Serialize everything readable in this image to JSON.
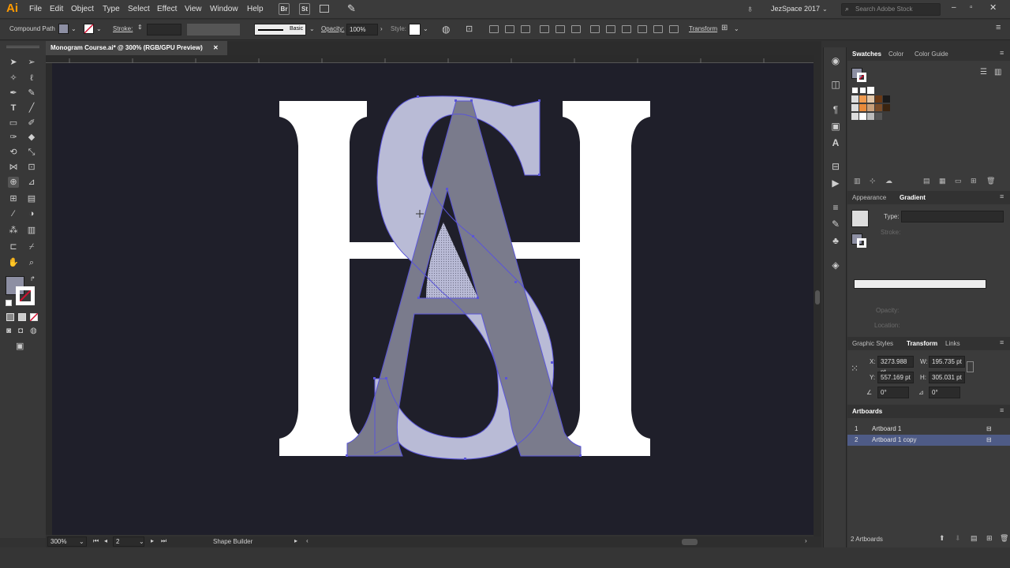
{
  "app": {
    "logo": "Ai",
    "workspace": "JezSpace 2017",
    "search_placeholder": "Search Adobe Stock"
  },
  "menu": [
    "File",
    "Edit",
    "Object",
    "Type",
    "Select",
    "Effect",
    "View",
    "Window",
    "Help"
  ],
  "bridge_buttons": [
    "Br",
    "St"
  ],
  "control": {
    "selection_type": "Compound Path",
    "stroke_label": "Stroke:",
    "brush": "Basic",
    "opacity_label": "Opacity:",
    "opacity_value": "100%",
    "style_label": "Style:",
    "transform_label": "Transform"
  },
  "document": {
    "tab_title": "Monogram Course.ai* @ 300% (RGB/GPU Preview)",
    "close": "✕"
  },
  "canvas": {
    "bg": "#1f1f2a",
    "letter_fill": "#ffffff",
    "overlay_light": "#b9bbd6",
    "overlay_dark": "#7a7b8c",
    "path_color": "#5a55d8"
  },
  "panels": {
    "swatches_tabs": [
      "Swatches",
      "Color",
      "Color Guide"
    ],
    "appearance_tabs": [
      "Appearance",
      "Gradient"
    ],
    "gradient": {
      "type_label": "Type:",
      "stroke_label": "Stroke:",
      "opacity_label": "Opacity:",
      "location_label": "Location:"
    },
    "transform_tabs": [
      "Graphic Styles",
      "Transform",
      "Links"
    ],
    "transform": {
      "x_label": "X:",
      "x_value": "3273.988 pt",
      "y_label": "Y:",
      "y_value": "557.169 pt",
      "w_label": "W:",
      "w_value": "195.735 pt",
      "h_label": "H:",
      "h_value": "305.031 pt",
      "angle": "0°",
      "shear": "0°"
    },
    "artboards_title": "Artboards",
    "artboards": [
      {
        "num": "1",
        "name": "Artboard 1"
      },
      {
        "num": "2",
        "name": "Artboard 1 copy"
      }
    ],
    "artboards_count": "2 Artboards"
  },
  "status": {
    "zoom": "300%",
    "artboard": "2",
    "tool": "Shape Builder"
  }
}
